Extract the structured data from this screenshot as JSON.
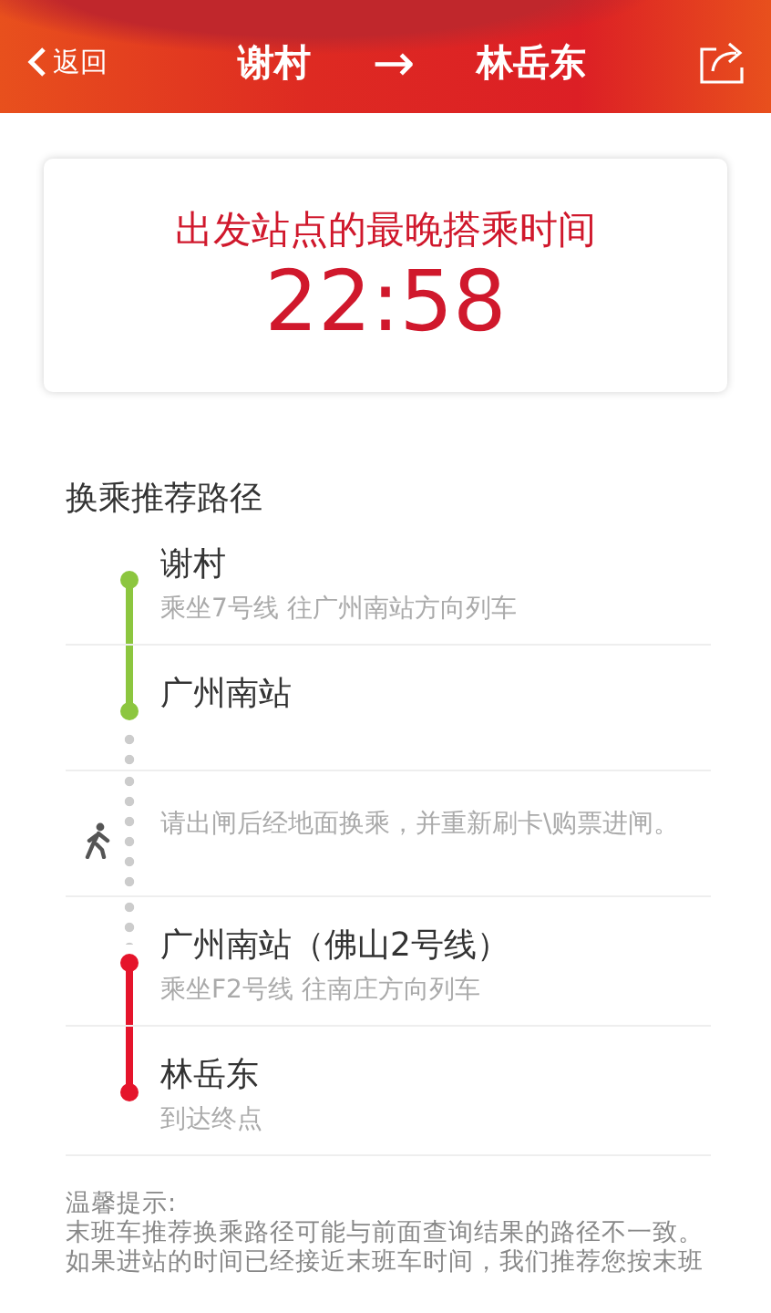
{
  "header": {
    "back": "返回",
    "from": "谢村",
    "arrow": "→",
    "to": "林岳东"
  },
  "card": {
    "label": "出发站点的最晚搭乘时间",
    "time": "22:58"
  },
  "section_title": "换乘推荐路径",
  "steps": [
    {
      "kind": "station",
      "name": "谢村",
      "note": "乘坐7号线 往广州南站方向列车",
      "color": "#8cc63f"
    },
    {
      "kind": "station",
      "name": "广州南站",
      "color": "#8cc63f"
    },
    {
      "kind": "walk",
      "note": "请出闸后经地面换乘，并重新刷卡\\购票进闸。"
    },
    {
      "kind": "station",
      "name": "广州南站（佛山2号线）",
      "note": "乘坐F2号线 往南庄方向列车",
      "color": "#e5142b"
    },
    {
      "kind": "station",
      "name": "林岳东",
      "note": "到达终点",
      "color": "#e5142b"
    }
  ],
  "tips": {
    "title": "温馨提示:",
    "lines": [
      "末班车推荐换乘路径可能与前面查询结果的路径不一致。",
      "如果进站的时间已经接近末班车时间，我们推荐您按末班"
    ]
  }
}
